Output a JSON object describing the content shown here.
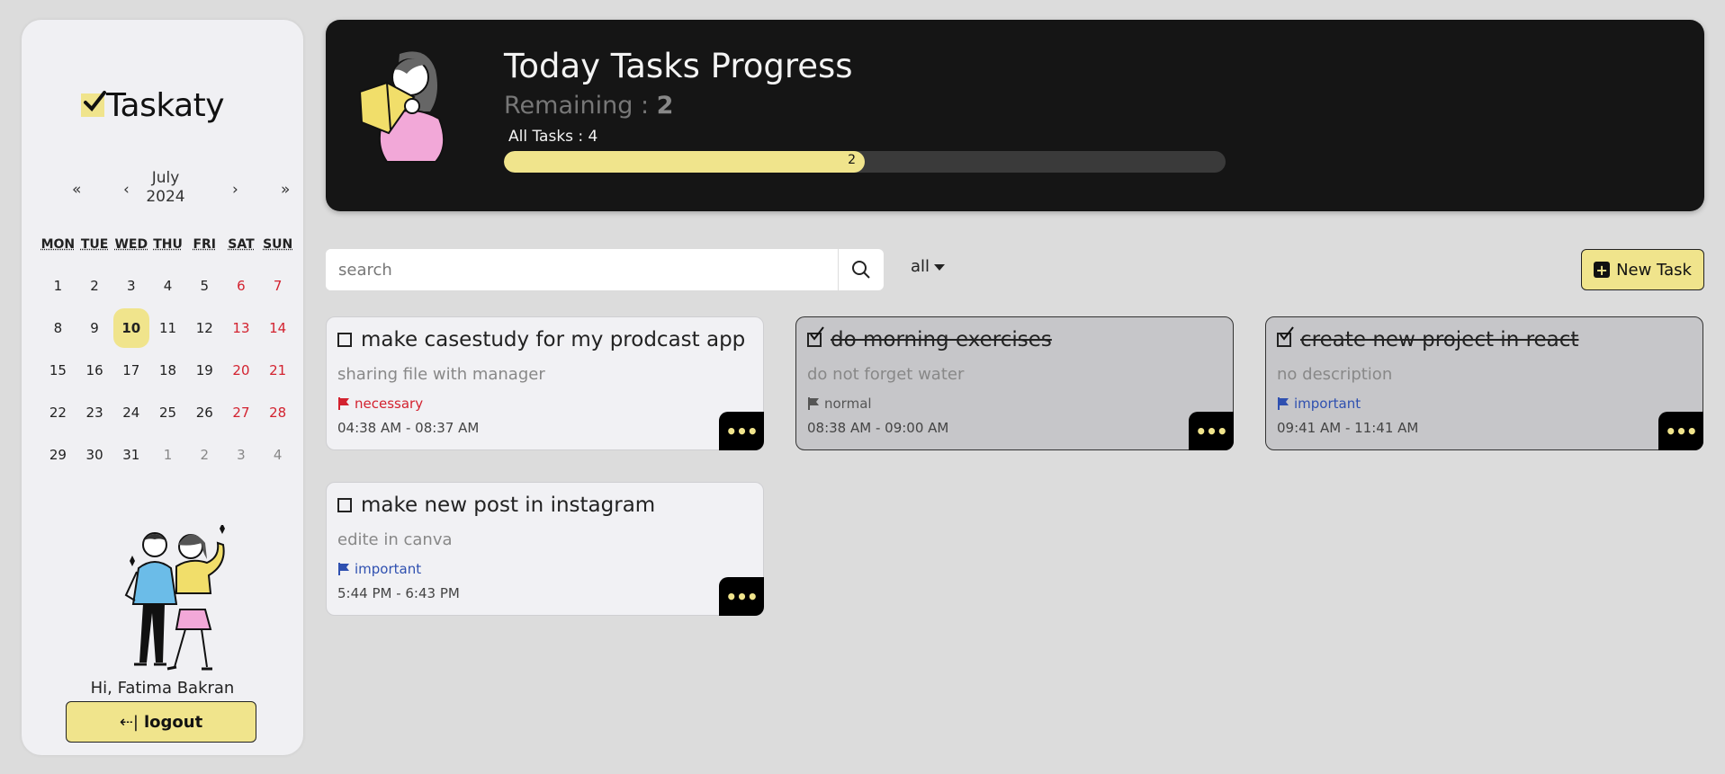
{
  "app": {
    "logo_text": "Taskaty"
  },
  "calendar": {
    "nav_first": "«",
    "nav_prev": "‹",
    "nav_next": "›",
    "nav_last": "»",
    "month": "July",
    "year": "2024",
    "weekdays": [
      "MON",
      "TUE",
      "WED",
      "THU",
      "FRI",
      "SAT",
      "SUN"
    ],
    "weeks": [
      [
        "1",
        "2",
        "3",
        "4",
        "5",
        "6",
        "7"
      ],
      [
        "8",
        "9",
        "10",
        "11",
        "12",
        "13",
        "14"
      ],
      [
        "15",
        "16",
        "17",
        "18",
        "19",
        "20",
        "21"
      ],
      [
        "22",
        "23",
        "24",
        "25",
        "26",
        "27",
        "28"
      ],
      [
        "29",
        "30",
        "31",
        "1",
        "2",
        "3",
        "4"
      ]
    ],
    "today": "10",
    "accent_color": "#f0e48c",
    "weekend_color": "#d3222f"
  },
  "user": {
    "greeting": "Hi, Fatima Bakran",
    "logout_label": "logout"
  },
  "banner": {
    "title": "Today Tasks Progress",
    "remaining_label": "Remaining : ",
    "remaining_value": "2",
    "all_tasks_label": "All Tasks : 4",
    "progress_value": "2",
    "progress_fraction": 0.5
  },
  "toolbar": {
    "search_placeholder": "search",
    "filter_value": "all",
    "new_task_label": "New Task"
  },
  "tasks": [
    {
      "title": "make casestudy for my prodcast app",
      "description": "sharing file with manager",
      "priority": "necessary",
      "priority_color": "#d3222f",
      "time": "04:38 AM - 08:37 AM",
      "completed": false,
      "menu_label": "•••"
    },
    {
      "title": "do morning exercises",
      "description": "do not forget water",
      "priority": "normal",
      "priority_color": "#555555",
      "time": "08:38 AM - 09:00 AM",
      "completed": true,
      "menu_label": "•••"
    },
    {
      "title": "create new project in react",
      "description": "no description",
      "priority": "important",
      "priority_color": "#2f50b0",
      "time": "09:41 AM - 11:41 AM",
      "completed": true,
      "menu_label": "•••"
    },
    {
      "title": "make new post in instagram",
      "description": "edite in canva",
      "priority": "important",
      "priority_color": "#2f50b0",
      "time": "5:44 PM - 6:43 PM",
      "completed": false,
      "menu_label": "•••"
    }
  ]
}
